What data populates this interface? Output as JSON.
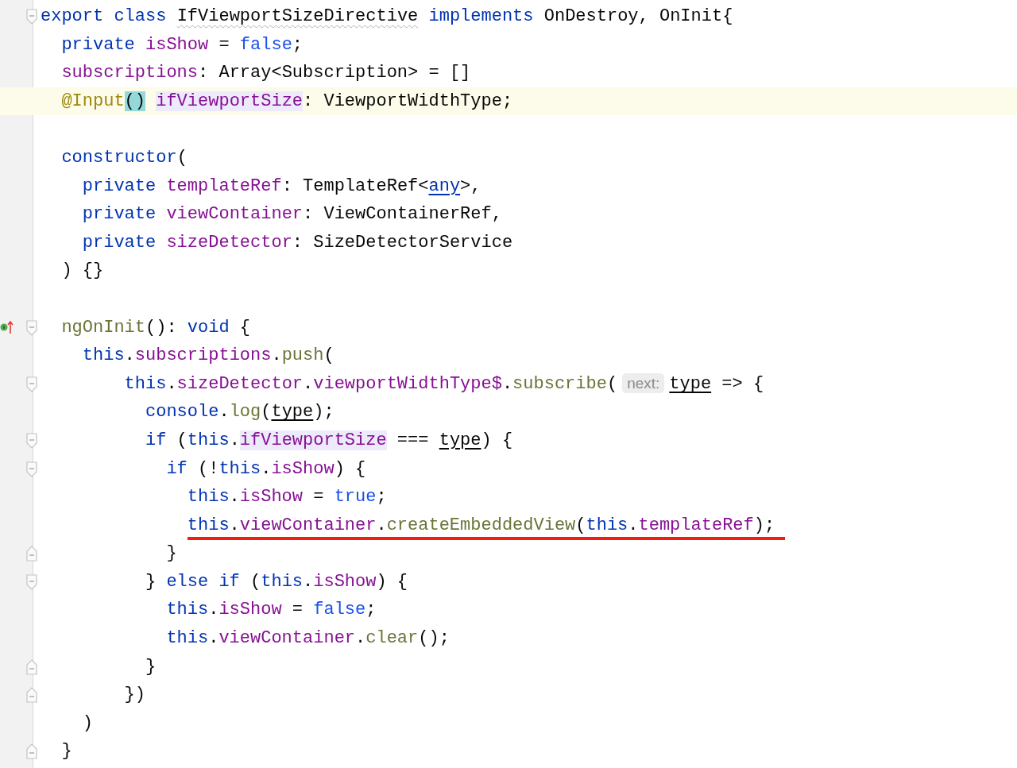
{
  "editor": {
    "lines": [
      {
        "fold_start": true,
        "fold_end": false,
        "implemented": false,
        "current": false,
        "marked": false,
        "tokens": [
          {
            "kind": "kw",
            "text": "export class "
          },
          {
            "kind": "plain",
            "text": "IfViewportSizeDirective",
            "warning": true
          },
          {
            "kind": "kw",
            "text": " implements"
          },
          {
            "kind": "plain",
            "text": " OnDestroy, OnInit{"
          }
        ],
        "children": [
          {
            "fold_start": false,
            "fold_end": false,
            "implemented": false,
            "current": false,
            "marked": false,
            "tokens": [
              {
                "kind": "kw",
                "text": "private "
              },
              {
                "kind": "field",
                "text": "isShow"
              },
              {
                "kind": "plain",
                "text": " = "
              },
              {
                "kind": "bool",
                "text": "false"
              },
              {
                "kind": "plain",
                "text": ";"
              }
            ]
          },
          {
            "fold_start": false,
            "fold_end": false,
            "implemented": false,
            "current": false,
            "marked": false,
            "tokens": [
              {
                "kind": "field",
                "text": "subscriptions"
              },
              {
                "kind": "plain",
                "text": ": Array<Subscription> = []"
              }
            ]
          },
          {
            "fold_start": false,
            "fold_end": false,
            "implemented": false,
            "current": true,
            "marked": false,
            "tokens": [
              {
                "kind": "decorator",
                "text": "@Input"
              },
              {
                "kind": "plain",
                "text": "()",
                "brace_highlight": true
              },
              {
                "kind": "field",
                "text": " ifViewportSize",
                "usage_highlight": true
              },
              {
                "kind": "plain",
                "text": ": ViewportWidthType;"
              }
            ]
          },
          {
            "fold_start": false,
            "fold_end": false,
            "implemented": false,
            "current": false,
            "marked": false
          },
          {
            "fold_start": false,
            "fold_end": false,
            "implemented": false,
            "current": false,
            "marked": false,
            "tokens": [
              {
                "kind": "kw",
                "text": "constructor"
              },
              {
                "kind": "plain",
                "text": "("
              }
            ],
            "children": [
              {
                "fold_start": false,
                "fold_end": false,
                "implemented": false,
                "current": false,
                "marked": false,
                "tokens": [
                  {
                    "kind": "kw",
                    "text": "private "
                  },
                  {
                    "kind": "field",
                    "text": "templateRef"
                  },
                  {
                    "kind": "plain",
                    "text": ": TemplateRef<"
                  },
                  {
                    "kind": "kw",
                    "text": "any",
                    "underline": true
                  },
                  {
                    "kind": "plain",
                    "text": ">,"
                  }
                ]
              },
              {
                "fold_start": false,
                "fold_end": false,
                "implemented": false,
                "current": false,
                "marked": false,
                "tokens": [
                  {
                    "kind": "kw",
                    "text": "private "
                  },
                  {
                    "kind": "field",
                    "text": "viewContainer"
                  },
                  {
                    "kind": "plain",
                    "text": ": ViewContainerRef,"
                  }
                ]
              },
              {
                "fold_start": false,
                "fold_end": false,
                "implemented": false,
                "current": false,
                "marked": false,
                "tokens": [
                  {
                    "kind": "kw",
                    "text": "private "
                  },
                  {
                    "kind": "field",
                    "text": "sizeDetector"
                  },
                  {
                    "kind": "plain",
                    "text": ": SizeDetectorService"
                  }
                ]
              }
            ]
          },
          {
            "fold_start": false,
            "fold_end": false,
            "implemented": false,
            "current": false,
            "marked": false,
            "tokens": [
              {
                "kind": "plain",
                "text": ") {}"
              }
            ]
          },
          {
            "fold_start": false,
            "fold_end": false,
            "implemented": false,
            "current": false,
            "marked": false
          },
          {
            "fold_start": true,
            "fold_end": false,
            "implemented": true,
            "current": false,
            "marked": false,
            "tokens": [
              {
                "kind": "fn",
                "text": "ngOnInit"
              },
              {
                "kind": "plain",
                "text": "(): "
              },
              {
                "kind": "kw",
                "text": "void"
              },
              {
                "kind": "plain",
                "text": " {"
              }
            ],
            "children": [
              {
                "fold_start": false,
                "fold_end": false,
                "implemented": false,
                "current": false,
                "marked": false,
                "tokens": [
                  {
                    "kind": "kw",
                    "text": "this"
                  },
                  {
                    "kind": "plain",
                    "text": "."
                  },
                  {
                    "kind": "field",
                    "text": "subscriptions"
                  },
                  {
                    "kind": "plain",
                    "text": "."
                  },
                  {
                    "kind": "fn",
                    "text": "push"
                  },
                  {
                    "kind": "plain",
                    "text": "("
                  }
                ],
                "children": [
                  {
                    "children": [
                      {
                        "fold_start": true,
                        "fold_end": false,
                        "implemented": false,
                        "current": false,
                        "marked": false,
                        "tokens": [
                          {
                            "kind": "kw",
                            "text": "this"
                          },
                          {
                            "kind": "plain",
                            "text": "."
                          },
                          {
                            "kind": "field",
                            "text": "sizeDetector"
                          },
                          {
                            "kind": "plain",
                            "text": "."
                          },
                          {
                            "kind": "field",
                            "text": "viewportWidthType$"
                          },
                          {
                            "kind": "plain",
                            "text": "."
                          },
                          {
                            "kind": "fn",
                            "text": "subscribe"
                          },
                          {
                            "kind": "plain",
                            "text": "("
                          },
                          {
                            "kind": "hint",
                            "text": "next:"
                          },
                          {
                            "kind": "plain",
                            "text": "type",
                            "underline": true
                          },
                          {
                            "kind": "plain",
                            "text": " => {"
                          }
                        ],
                        "children": [
                          {
                            "fold_start": false,
                            "fold_end": false,
                            "implemented": false,
                            "current": false,
                            "marked": false,
                            "tokens": [
                              {
                                "kind": "kw",
                                "text": "console"
                              },
                              {
                                "kind": "plain",
                                "text": "."
                              },
                              {
                                "kind": "fn",
                                "text": "log"
                              },
                              {
                                "kind": "plain",
                                "text": "("
                              },
                              {
                                "kind": "plain",
                                "text": "type",
                                "underline": true
                              },
                              {
                                "kind": "plain",
                                "text": ");"
                              }
                            ]
                          },
                          {
                            "fold_start": true,
                            "fold_end": false,
                            "implemented": false,
                            "current": false,
                            "marked": false,
                            "tokens": [
                              {
                                "kind": "kw",
                                "text": "if"
                              },
                              {
                                "kind": "plain",
                                "text": " ("
                              },
                              {
                                "kind": "kw",
                                "text": "this"
                              },
                              {
                                "kind": "plain",
                                "text": "."
                              },
                              {
                                "kind": "field",
                                "text": "ifViewportSize",
                                "usage_highlight": true
                              },
                              {
                                "kind": "plain",
                                "text": " === "
                              },
                              {
                                "kind": "plain",
                                "text": "type",
                                "underline": true
                              },
                              {
                                "kind": "plain",
                                "text": ") {"
                              }
                            ],
                            "children": [
                              {
                                "fold_start": true,
                                "fold_end": false,
                                "implemented": false,
                                "current": false,
                                "marked": false,
                                "tokens": [
                                  {
                                    "kind": "kw",
                                    "text": "if"
                                  },
                                  {
                                    "kind": "plain",
                                    "text": " (!"
                                  },
                                  {
                                    "kind": "kw",
                                    "text": "this"
                                  },
                                  {
                                    "kind": "plain",
                                    "text": "."
                                  },
                                  {
                                    "kind": "field",
                                    "text": "isShow"
                                  },
                                  {
                                    "kind": "plain",
                                    "text": ") {"
                                  }
                                ],
                                "children": [
                                  {
                                    "fold_start": false,
                                    "fold_end": false,
                                    "implemented": false,
                                    "current": false,
                                    "marked": false,
                                    "tokens": [
                                      {
                                        "kind": "kw",
                                        "text": "this"
                                      },
                                      {
                                        "kind": "plain",
                                        "text": "."
                                      },
                                      {
                                        "kind": "field",
                                        "text": "isShow"
                                      },
                                      {
                                        "kind": "plain",
                                        "text": " = "
                                      },
                                      {
                                        "kind": "bool",
                                        "text": "true"
                                      },
                                      {
                                        "kind": "plain",
                                        "text": ";"
                                      }
                                    ]
                                  },
                                  {
                                    "fold_start": false,
                                    "fold_end": false,
                                    "implemented": false,
                                    "current": false,
                                    "marked": true,
                                    "tokens": [
                                      {
                                        "kind": "kw",
                                        "text": "this"
                                      },
                                      {
                                        "kind": "plain",
                                        "text": "."
                                      },
                                      {
                                        "kind": "field",
                                        "text": "viewContainer"
                                      },
                                      {
                                        "kind": "plain",
                                        "text": "."
                                      },
                                      {
                                        "kind": "fn",
                                        "text": "createEmbeddedView"
                                      },
                                      {
                                        "kind": "plain",
                                        "text": "("
                                      },
                                      {
                                        "kind": "kw",
                                        "text": "this"
                                      },
                                      {
                                        "kind": "plain",
                                        "text": "."
                                      },
                                      {
                                        "kind": "field",
                                        "text": "templateRef"
                                      },
                                      {
                                        "kind": "plain",
                                        "text": ");"
                                      }
                                    ]
                                  }
                                ]
                              },
                              {
                                "fold_start": false,
                                "fold_end": true,
                                "implemented": false,
                                "current": false,
                                "marked": false,
                                "tokens": [
                                  {
                                    "kind": "plain",
                                    "text": "}"
                                  }
                                ]
                              }
                            ]
                          },
                          {
                            "fold_start": true,
                            "fold_end": false,
                            "implemented": false,
                            "current": false,
                            "marked": false,
                            "tokens": [
                              {
                                "kind": "plain",
                                "text": "} "
                              },
                              {
                                "kind": "kw",
                                "text": "else if"
                              },
                              {
                                "kind": "plain",
                                "text": " ("
                              },
                              {
                                "kind": "kw",
                                "text": "this"
                              },
                              {
                                "kind": "plain",
                                "text": "."
                              },
                              {
                                "kind": "field",
                                "text": "isShow"
                              },
                              {
                                "kind": "plain",
                                "text": ") {"
                              }
                            ],
                            "children": [
                              {
                                "fold_start": false,
                                "fold_end": false,
                                "implemented": false,
                                "current": false,
                                "marked": false,
                                "tokens": [
                                  {
                                    "kind": "kw",
                                    "text": "this"
                                  },
                                  {
                                    "kind": "plain",
                                    "text": "."
                                  },
                                  {
                                    "kind": "field",
                                    "text": "isShow"
                                  },
                                  {
                                    "kind": "plain",
                                    "text": " = "
                                  },
                                  {
                                    "kind": "bool",
                                    "text": "false"
                                  },
                                  {
                                    "kind": "plain",
                                    "text": ";"
                                  }
                                ]
                              },
                              {
                                "fold_start": false,
                                "fold_end": false,
                                "implemented": false,
                                "current": false,
                                "marked": false,
                                "tokens": [
                                  {
                                    "kind": "kw",
                                    "text": "this"
                                  },
                                  {
                                    "kind": "plain",
                                    "text": "."
                                  },
                                  {
                                    "kind": "field",
                                    "text": "viewContainer"
                                  },
                                  {
                                    "kind": "plain",
                                    "text": "."
                                  },
                                  {
                                    "kind": "fn",
                                    "text": "clear"
                                  },
                                  {
                                    "kind": "plain",
                                    "text": "();"
                                  }
                                ]
                              }
                            ]
                          },
                          {
                            "fold_start": false,
                            "fold_end": true,
                            "implemented": false,
                            "current": false,
                            "marked": false,
                            "tokens": [
                              {
                                "kind": "plain",
                                "text": "}"
                              }
                            ]
                          }
                        ]
                      },
                      {
                        "fold_start": false,
                        "fold_end": true,
                        "implemented": false,
                        "current": false,
                        "marked": false,
                        "tokens": [
                          {
                            "kind": "plain",
                            "text": "})"
                          }
                        ]
                      }
                    ]
                  }
                ]
              },
              {
                "fold_start": false,
                "fold_end": false,
                "implemented": false,
                "current": false,
                "marked": false,
                "tokens": [
                  {
                    "kind": "plain",
                    "text": ")"
                  }
                ]
              }
            ]
          },
          {
            "fold_start": false,
            "fold_end": true,
            "implemented": false,
            "current": false,
            "marked": false,
            "tokens": [
              {
                "kind": "plain",
                "text": "}"
              }
            ]
          }
        ]
      }
    ]
  }
}
